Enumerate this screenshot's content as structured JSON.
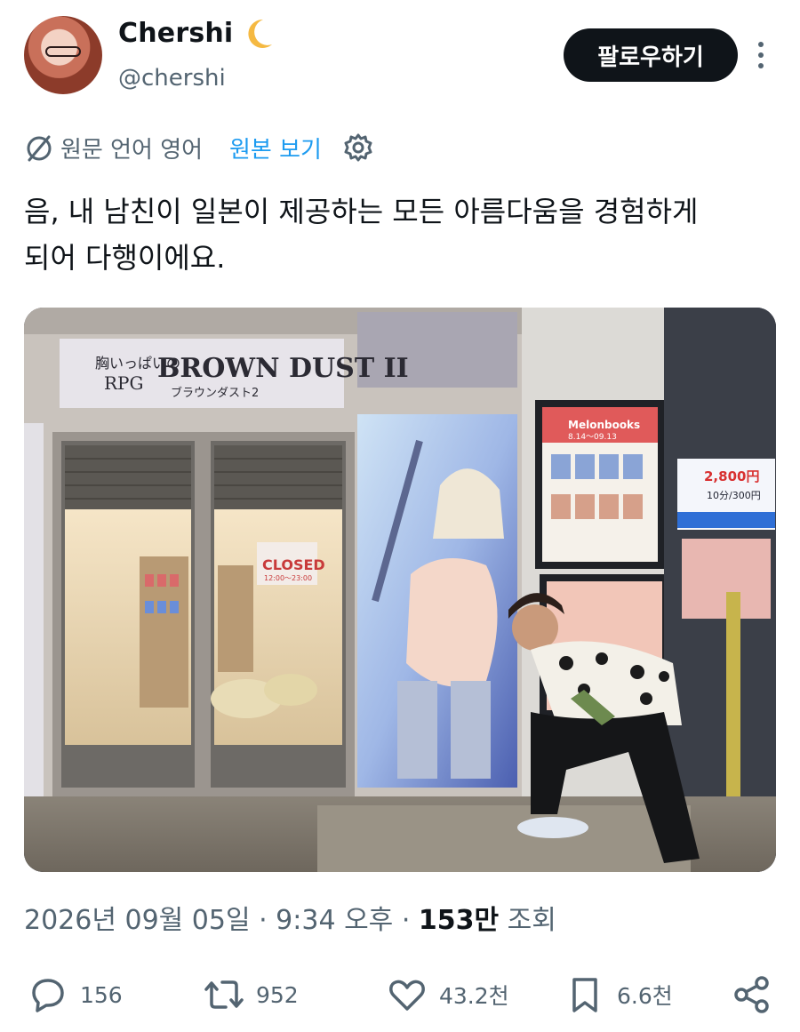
{
  "author": {
    "display_name": "Chershi",
    "handle": "@chershi",
    "follow_label": "팔로우하기"
  },
  "translation": {
    "label": "원문 언어 영어",
    "view_original_label": "원본 보기"
  },
  "tweet": {
    "text": "음, 내 남친이 일본이 제공하는 모든 아름다움을 경험하게\n되어 다행이에요."
  },
  "photo": {
    "sign_small": "胸いっぱいの",
    "sign_rpg": "RPG",
    "sign_title": "BROWN DUST II",
    "sign_kana": "ブラウンダスト2",
    "closed_label": "CLOSED",
    "closed_hours": "12:00〜23:00",
    "price": "2,800円",
    "price_sub": "10分/300円",
    "poster_brand": "Melonbooks",
    "poster_dates": "8.14〜09.13"
  },
  "meta": {
    "datetime": "2026년 09월 05일 · 9:34 오후 · ",
    "views": "153만",
    "views_label": " 조회"
  },
  "actions": {
    "replies": "156",
    "reposts": "952",
    "likes": "43.2천",
    "bookmarks": "6.6천"
  },
  "colors": {
    "accent": "#1d9bf0",
    "secondary_text": "#536471",
    "primary_text": "#0f1419"
  }
}
